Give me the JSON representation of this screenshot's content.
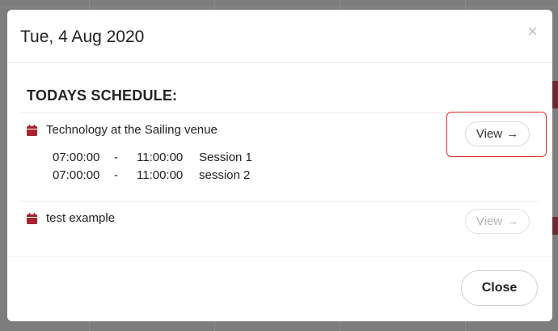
{
  "modal": {
    "title": "Tue, 4 Aug 2020",
    "close_glyph": "×",
    "section_title": "TODAYS SCHEDULE:",
    "events": [
      {
        "title": "Technology at the Sailing venue",
        "icon": "calendar-icon",
        "view_label": "View",
        "view_enabled": true,
        "highlighted": true,
        "sessions": [
          {
            "start": "07:00:00",
            "dash": "-",
            "end": "11:00:00",
            "name": "Session 1"
          },
          {
            "start": "07:00:00",
            "dash": "-",
            "end": "11:00:00",
            "name": "session 2"
          }
        ]
      },
      {
        "title": "test example",
        "icon": "calendar-icon",
        "view_label": "View",
        "view_enabled": false,
        "sessions": []
      }
    ],
    "close_button_label": "Close"
  },
  "colors": {
    "accent_icon": "#a8232f",
    "highlight_border": "#e53030",
    "overlay": "#7d7d7d"
  }
}
